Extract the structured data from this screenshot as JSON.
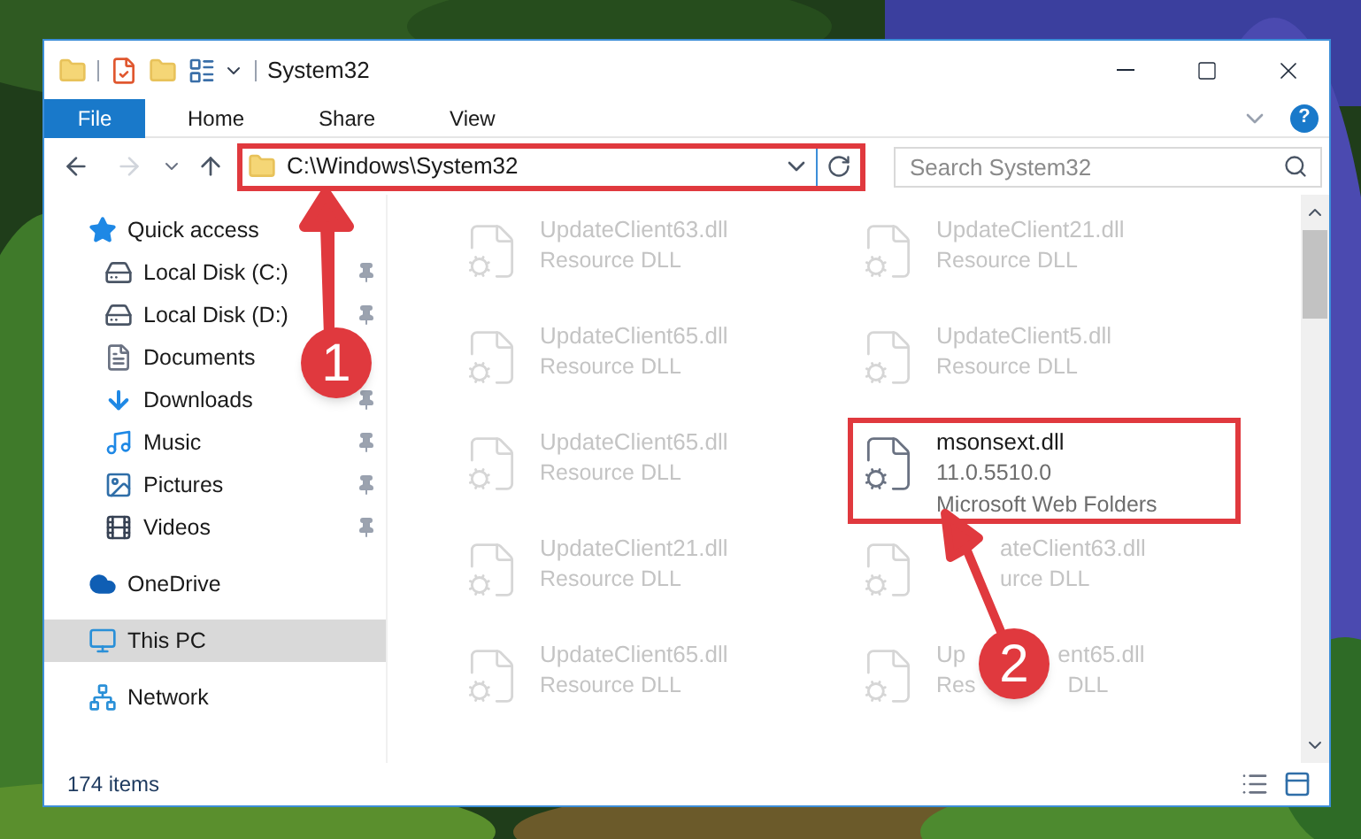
{
  "window": {
    "title": "System32"
  },
  "ribbon": {
    "tabs": [
      {
        "label": "File",
        "selected": true
      },
      {
        "label": "Home",
        "selected": false
      },
      {
        "label": "Share",
        "selected": false
      },
      {
        "label": "View",
        "selected": false
      }
    ],
    "help": "?"
  },
  "address": {
    "path": "C:\\Windows\\System32",
    "highlighted": true
  },
  "search": {
    "placeholder": "Search System32"
  },
  "navigation": {
    "items": [
      {
        "label": "Quick access",
        "kind": "quick-access",
        "selected": false,
        "children": [
          {
            "label": "Local Disk (C:)",
            "kind": "system-drive",
            "pinned": true,
            "selected": false
          },
          {
            "label": "Local Disk (D:)",
            "kind": "drive",
            "pinned": true,
            "selected": false
          },
          {
            "label": "Documents",
            "kind": "documents",
            "selected": false
          },
          {
            "label": "Downloads",
            "kind": "downloads",
            "pinned": true,
            "selected": false
          },
          {
            "label": "Music",
            "kind": "music",
            "pinned": true,
            "selected": false
          },
          {
            "label": "Pictures",
            "kind": "pictures",
            "pinned": true,
            "selected": false
          },
          {
            "label": "Videos",
            "kind": "videos",
            "pinned": true,
            "selected": false
          }
        ]
      },
      {
        "label": "OneDrive",
        "kind": "cloud",
        "selected": false
      },
      {
        "label": "This PC",
        "kind": "pc",
        "selected": true
      },
      {
        "label": "Network",
        "kind": "network",
        "selected": false
      }
    ]
  },
  "files": [
    {
      "name": [
        {
          "text": "UpdateClient63.dll",
          "kind": "plain"
        }
      ],
      "details": [
        [
          {
            "text": "Resource DLL",
            "kind": "plain"
          }
        ]
      ],
      "highlighted": false,
      "blurred": true
    },
    {
      "name": [
        {
          "text": "UpdateClient21.dll",
          "kind": "plain"
        }
      ],
      "details": [
        [
          {
            "text": "Resource DLL",
            "kind": "plain"
          }
        ]
      ],
      "highlighted": false,
      "blurred": true
    },
    {
      "name": [
        {
          "text": "UpdateClient65.dll",
          "kind": "plain"
        }
      ],
      "details": [
        [
          {
            "text": "Resource DLL",
            "kind": "plain"
          }
        ]
      ],
      "highlighted": false,
      "blurred": true
    },
    {
      "name": [
        {
          "text": "UpdateClient5.dll",
          "kind": "plain"
        }
      ],
      "details": [
        [
          {
            "text": "Resource DLL",
            "kind": "plain"
          }
        ]
      ],
      "highlighted": false,
      "blurred": true
    },
    {
      "name": [
        {
          "text": "UpdateClient65.dll",
          "kind": "plain"
        }
      ],
      "details": [
        [
          {
            "text": "Resource DLL",
            "kind": "plain"
          }
        ]
      ],
      "highlighted": false,
      "blurred": true
    },
    {
      "name": [
        {
          "text": "msonsext.dll",
          "kind": "plain"
        }
      ],
      "details": [
        [
          {
            "text": "11.0.5510.0",
            "kind": "plain"
          }
        ],
        [
          {
            "text": "Microsoft Web Folders",
            "kind": "plain"
          }
        ]
      ],
      "highlighted": true,
      "blurred": false
    },
    {
      "name": [
        {
          "text": "UpdateClient21.dll",
          "kind": "plain"
        }
      ],
      "details": [
        [
          {
            "text": "Resource DLL",
            "kind": "plain"
          }
        ]
      ],
      "highlighted": false,
      "blurred": true
    },
    {
      "name": [
        {
          "text": "ateClient63.dll",
          "kind": "after-short-gap"
        }
      ],
      "details": [
        [
          {
            "text": "urce DLL",
            "kind": "after-short-gap"
          }
        ]
      ],
      "highlighted": false,
      "blurred": true
    },
    {
      "name": [
        {
          "text": "UpdateClient65.dll",
          "kind": "plain"
        }
      ],
      "details": [
        [
          {
            "text": "Resource DLL",
            "kind": "plain"
          }
        ]
      ],
      "highlighted": false,
      "blurred": true
    },
    {
      "name": [
        {
          "text": "Up",
          "kind": "plain"
        },
        {
          "text": "ent65.dll",
          "kind": "after-long-gap"
        }
      ],
      "details": [
        [
          {
            "text": "Res",
            "kind": "plain"
          },
          {
            "text": "DLL",
            "kind": "after-long-gap"
          }
        ]
      ],
      "highlighted": false,
      "blurred": true
    }
  ],
  "status_bar": {
    "item_count": "174 items"
  },
  "annotations": [
    {
      "label": "1"
    },
    {
      "label": "2"
    }
  ]
}
